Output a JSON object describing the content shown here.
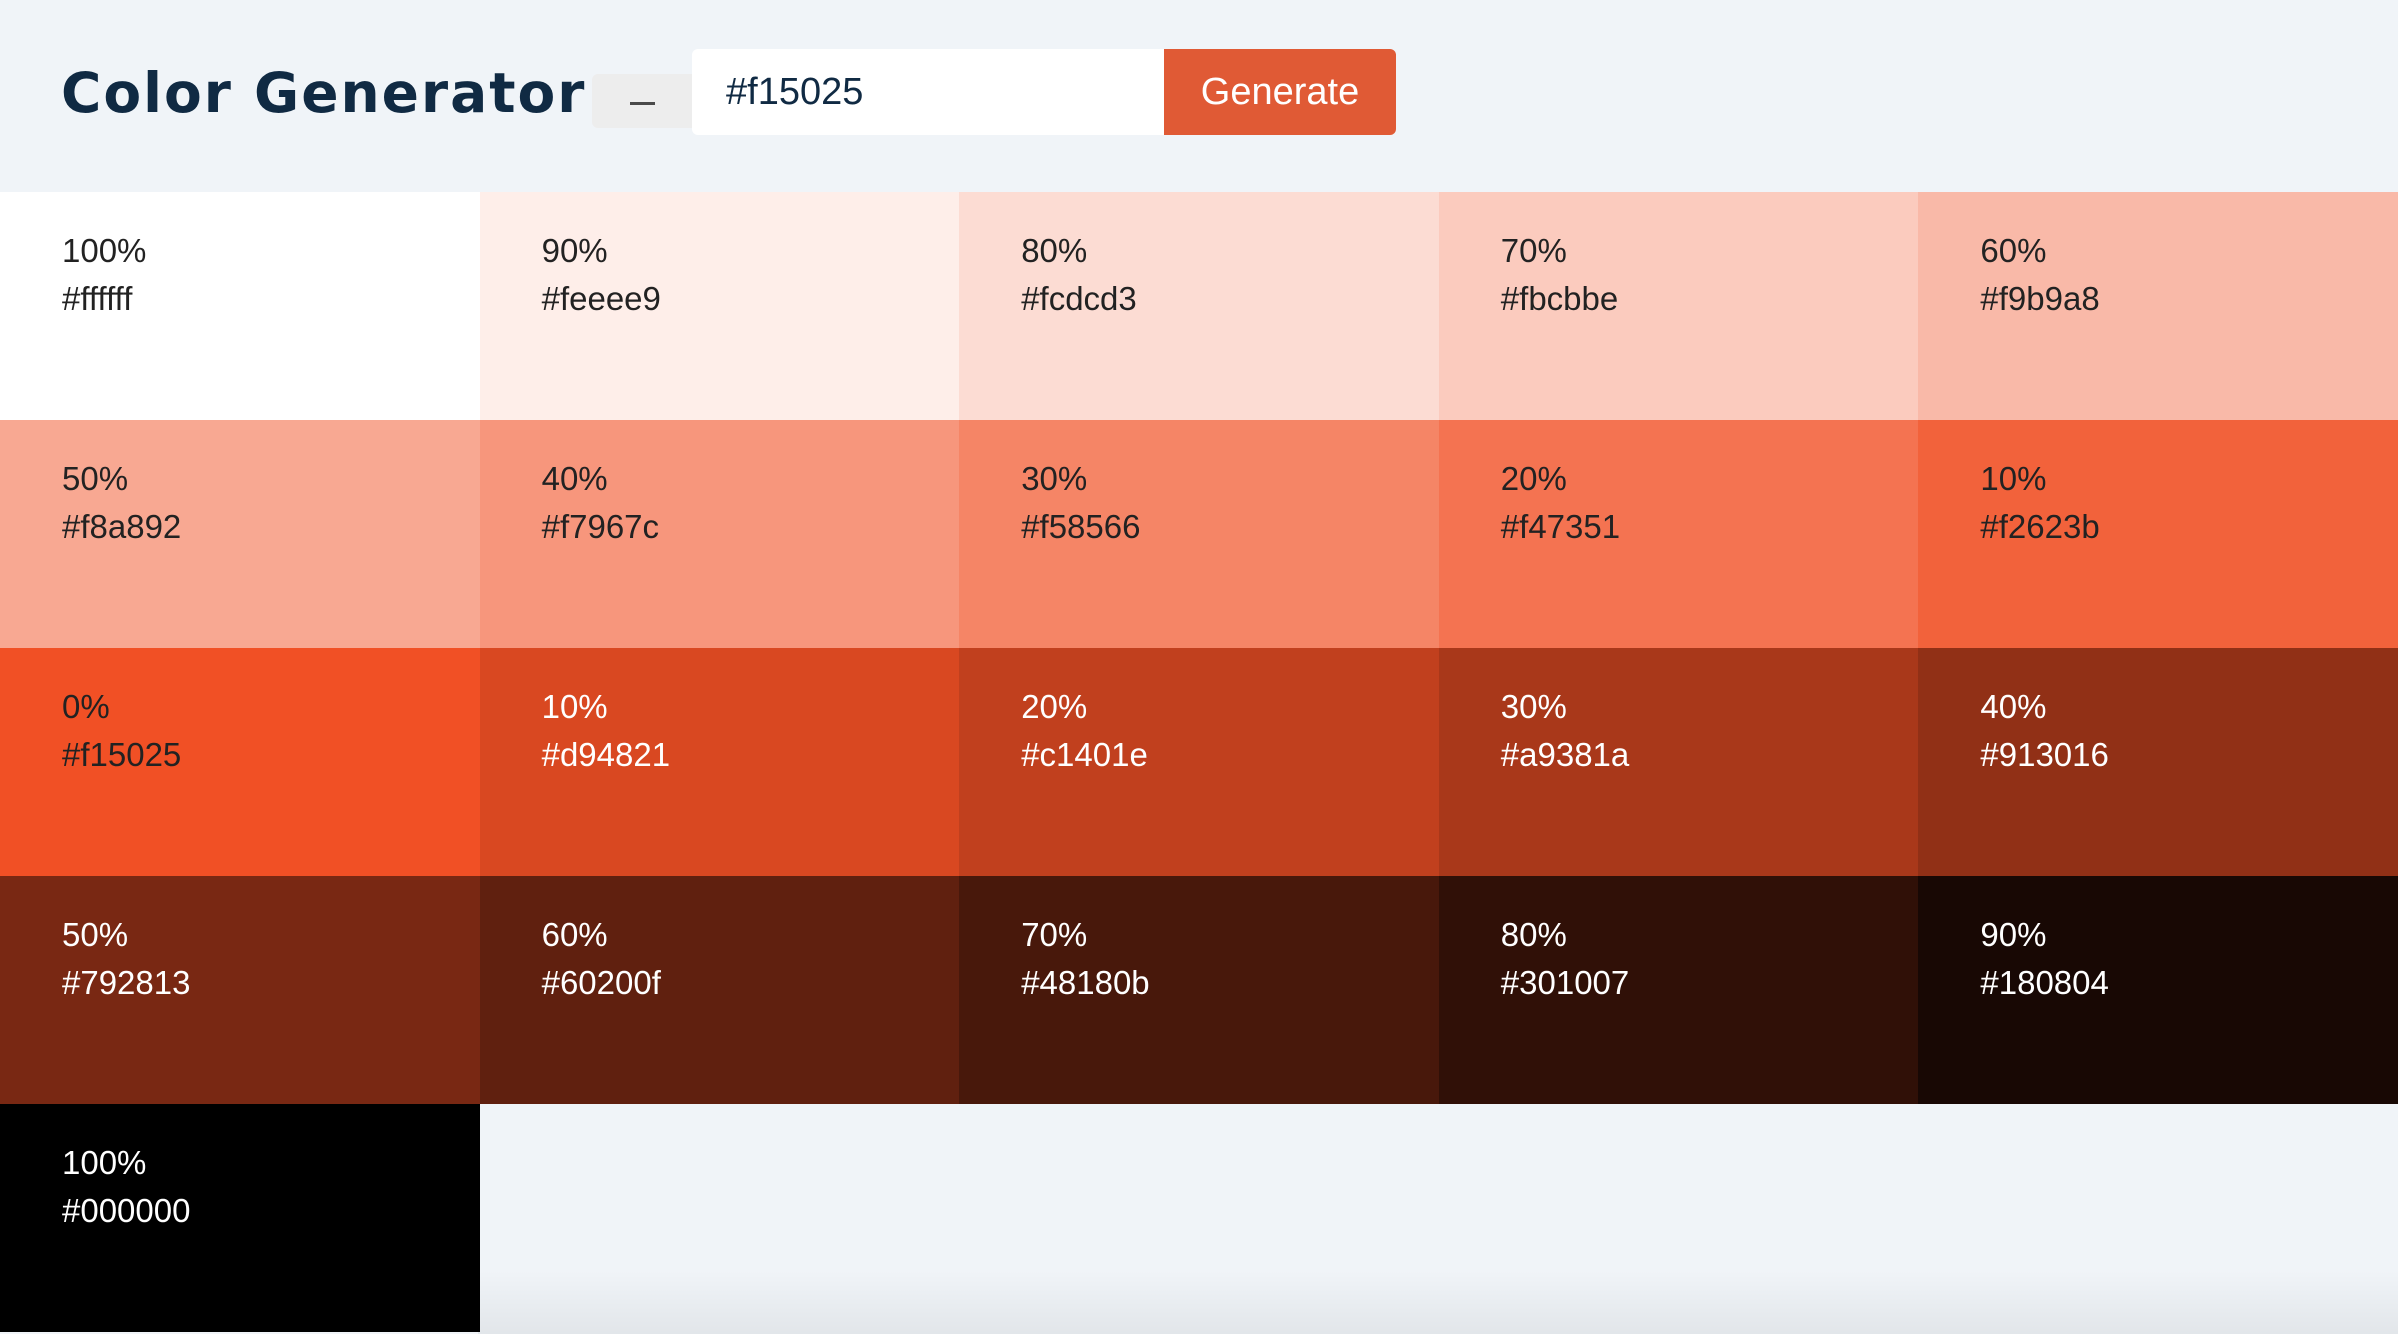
{
  "header": {
    "title": "Color Generator",
    "input_value": "#f15025",
    "generate_label": "Generate"
  },
  "swatches": [
    {
      "pct": "100%",
      "hex": "#ffffff",
      "tone": "light"
    },
    {
      "pct": "90%",
      "hex": "#feeee9",
      "tone": "light"
    },
    {
      "pct": "80%",
      "hex": "#fcdcd3",
      "tone": "light"
    },
    {
      "pct": "70%",
      "hex": "#fbcbbe",
      "tone": "light"
    },
    {
      "pct": "60%",
      "hex": "#f9b9a8",
      "tone": "light"
    },
    {
      "pct": "50%",
      "hex": "#f8a892",
      "tone": "light"
    },
    {
      "pct": "40%",
      "hex": "#f7967c",
      "tone": "light"
    },
    {
      "pct": "30%",
      "hex": "#f58566",
      "tone": "light"
    },
    {
      "pct": "20%",
      "hex": "#f47351",
      "tone": "light"
    },
    {
      "pct": "10%",
      "hex": "#f2623b",
      "tone": "light"
    },
    {
      "pct": "0%",
      "hex": "#f15025",
      "tone": "light"
    },
    {
      "pct": "10%",
      "hex": "#d94821",
      "tone": "dark"
    },
    {
      "pct": "20%",
      "hex": "#c1401e",
      "tone": "dark"
    },
    {
      "pct": "30%",
      "hex": "#a9381a",
      "tone": "dark"
    },
    {
      "pct": "40%",
      "hex": "#913016",
      "tone": "dark"
    },
    {
      "pct": "50%",
      "hex": "#792813",
      "tone": "dark"
    },
    {
      "pct": "60%",
      "hex": "#60200f",
      "tone": "dark"
    },
    {
      "pct": "70%",
      "hex": "#48180b",
      "tone": "dark"
    },
    {
      "pct": "80%",
      "hex": "#301007",
      "tone": "dark"
    },
    {
      "pct": "90%",
      "hex": "#180804",
      "tone": "dark"
    },
    {
      "pct": "100%",
      "hex": "#000000",
      "tone": "dark"
    }
  ],
  "colors": {
    "page_background": "#f0f4f8",
    "title": "#102a43",
    "button": "#e05a35",
    "picker_swatch": "#ededed"
  }
}
